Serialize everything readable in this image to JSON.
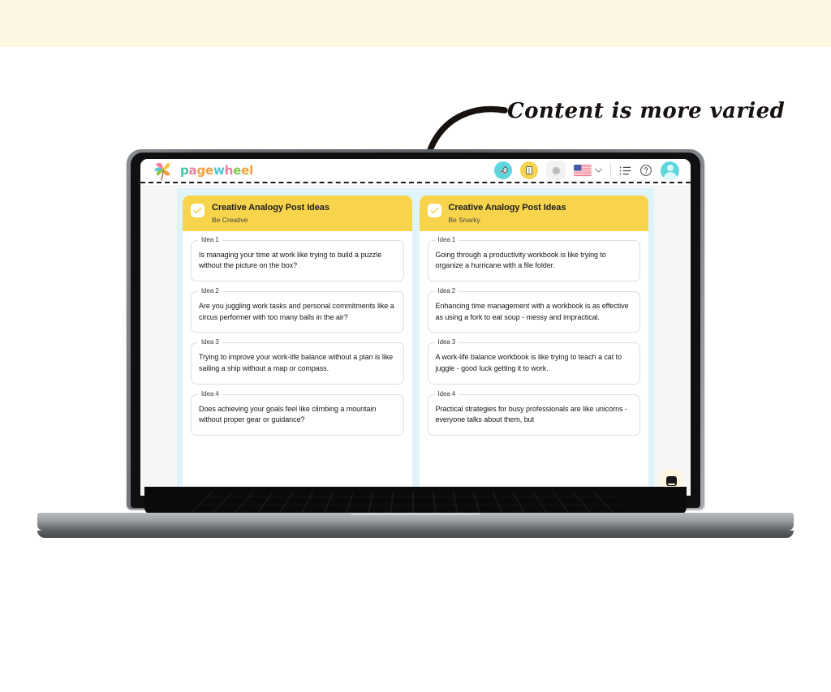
{
  "banner": {
    "color": "#fdf6e3"
  },
  "annotation": {
    "text": "Content is more varied",
    "arrow_icon": "curved-arrow-icon"
  },
  "app": {
    "header": {
      "logo_icon": "pinwheel-logo-icon",
      "wordmark": "pagewheel",
      "wordmark_letters": [
        {
          "ch": "p",
          "color": "#3fc6a8"
        },
        {
          "ch": "a",
          "color": "#f07ea0"
        },
        {
          "ch": "g",
          "color": "#f5a03c"
        },
        {
          "ch": "e",
          "color": "#f5a03c"
        },
        {
          "ch": "w",
          "color": "#4cc8d8"
        },
        {
          "ch": "h",
          "color": "#f07ea0"
        },
        {
          "ch": "e",
          "color": "#7ac943"
        },
        {
          "ch": "e",
          "color": "#f5a03c"
        },
        {
          "ch": "l",
          "color": "#f5a03c"
        }
      ],
      "tools": [
        {
          "name": "rocket-button",
          "icon": "rocket-icon",
          "style": "cyan"
        },
        {
          "name": "book-button",
          "icon": "book-icon",
          "style": "yellow"
        },
        {
          "name": "settings-button",
          "icon": "gear-icon",
          "style": "plain"
        },
        {
          "name": "language-selector",
          "icon": "us-flag-icon",
          "chevron": "chevron-down-icon"
        },
        {
          "name": "list-button",
          "icon": "list-icon",
          "style": "plain"
        },
        {
          "name": "help-button",
          "icon": "question-circle-icon",
          "style": "plain"
        },
        {
          "name": "account-avatar",
          "icon": "avatar-icon",
          "style": "cyan"
        }
      ]
    },
    "chat_widget": {
      "icon": "chat-bubble-icon"
    },
    "columns": [
      {
        "title": "Creative Analogy Post Ideas",
        "subtitle": "Be Creative",
        "checked": true,
        "ideas": [
          {
            "label": "Idea 1",
            "text": "Is managing your time at work like trying to build a puzzle without the picture on the box?"
          },
          {
            "label": "Idea 2",
            "text": "Are you juggling work tasks and personal commitments like a circus performer with too many balls in the air?"
          },
          {
            "label": "Idea 3",
            "text": "Trying to improve your work-life balance without a plan is like sailing a ship without a map or compass."
          },
          {
            "label": "Idea 4",
            "text": "Does achieving your goals feel like climbing a mountain without proper gear or guidance?"
          }
        ]
      },
      {
        "title": "Creative Analogy Post Ideas",
        "subtitle": "Be Snarky",
        "checked": true,
        "ideas": [
          {
            "label": "Idea 1",
            "text": "Going through a productivity workbook is like trying to organize a hurricane with a file folder."
          },
          {
            "label": "Idea 2",
            "text": "Enhancing time management with a workbook is as effective as using a fork to eat soup - messy and impractical."
          },
          {
            "label": "Idea 3",
            "text": "A work-life balance workbook is like trying to teach a cat to juggle - good luck getting it to work."
          },
          {
            "label": "Idea 4",
            "text": "Practical strategies for busy professionals are like unicorns - everyone talks about them, but"
          }
        ]
      }
    ]
  },
  "colors": {
    "banner": "#fdf6e3",
    "card_header": "#f7d44c",
    "panel": "#dff4fa",
    "accent_cyan": "#5fd6dd",
    "accent_yellow": "#f5d44f"
  }
}
